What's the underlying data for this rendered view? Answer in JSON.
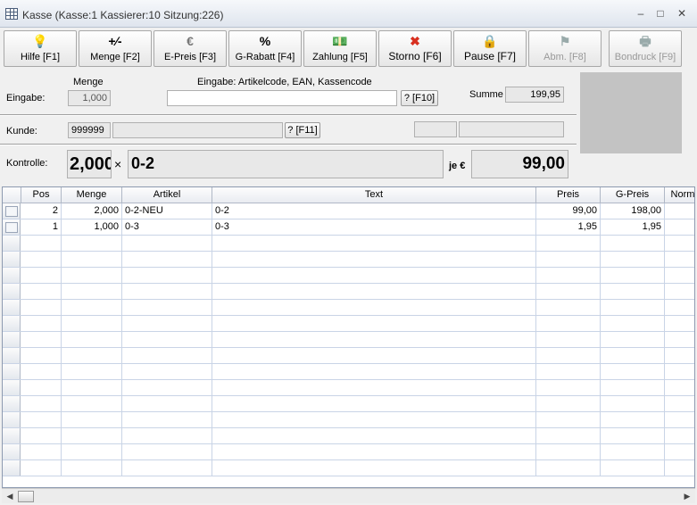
{
  "window": {
    "title": "Kasse (Kasse:1 Kassierer:10 Sitzung:226)",
    "controls": {
      "minimize": "–",
      "maximize": "□",
      "close": "✕"
    }
  },
  "toolbar": {
    "buttons": [
      {
        "label": "Hilfe [F1]",
        "icon": "lightbulb-icon",
        "glyph": "💡",
        "enabled": true
      },
      {
        "label": "Menge [F2]",
        "icon": "plus-minus-icon",
        "glyph": "+∕₋",
        "enabled": true
      },
      {
        "label": "E-Preis [F3]",
        "icon": "euro-icon",
        "glyph": "€",
        "enabled": true
      },
      {
        "label": "G-Rabatt [F4]",
        "icon": "percent-icon",
        "glyph": "%",
        "enabled": true
      },
      {
        "label": "Zahlung [F5]",
        "icon": "money-icon",
        "glyph": "💵",
        "enabled": true
      },
      {
        "label": "Storno [F6]",
        "icon": "red-x-icon",
        "glyph": "✖",
        "enabled": true
      },
      {
        "label": "Pause [F7]",
        "icon": "lock-icon",
        "glyph": "🔒",
        "enabled": true
      },
      {
        "label": "Abm. [F8]",
        "icon": "flag-icon",
        "glyph": "⚑",
        "enabled": false
      },
      {
        "label": "Bondruck [F9]",
        "icon": "printer-icon",
        "glyph": "🖶",
        "enabled": false
      }
    ]
  },
  "entry": {
    "label": "Eingabe:",
    "menge_label": "Menge",
    "menge_value": "1,000",
    "input_label": "Eingabe: Artikelcode, EAN, Kassencode",
    "input_value": "",
    "lookup_button": "? [F10]",
    "summe_label": "Summe",
    "summe_value": "199,95"
  },
  "customer": {
    "label": "Kunde:",
    "number": "999999",
    "name": "",
    "lookup_button": "? [F11]",
    "extra1": "",
    "extra2": ""
  },
  "control": {
    "label": "Kontrolle:",
    "quantity": "2,000",
    "times": "×",
    "article": "0-2",
    "per_label": "je €",
    "price": "99,00"
  },
  "table": {
    "columns": [
      "Pos",
      "Menge",
      "Artikel",
      "Text",
      "Preis",
      "G-Preis",
      "Norm"
    ],
    "rows": [
      [
        "2",
        "2,000",
        "0-2-NEU",
        "0-2",
        "99,00",
        "198,00",
        ""
      ],
      [
        "1",
        "1,000",
        "0-3",
        "0-3",
        "1,95",
        "1,95",
        ""
      ]
    ],
    "empty_rows": 15
  },
  "colors": {
    "grid_border": "#8d9ab0",
    "storno_icon": "#d83020",
    "disabled_text": "#999999"
  }
}
